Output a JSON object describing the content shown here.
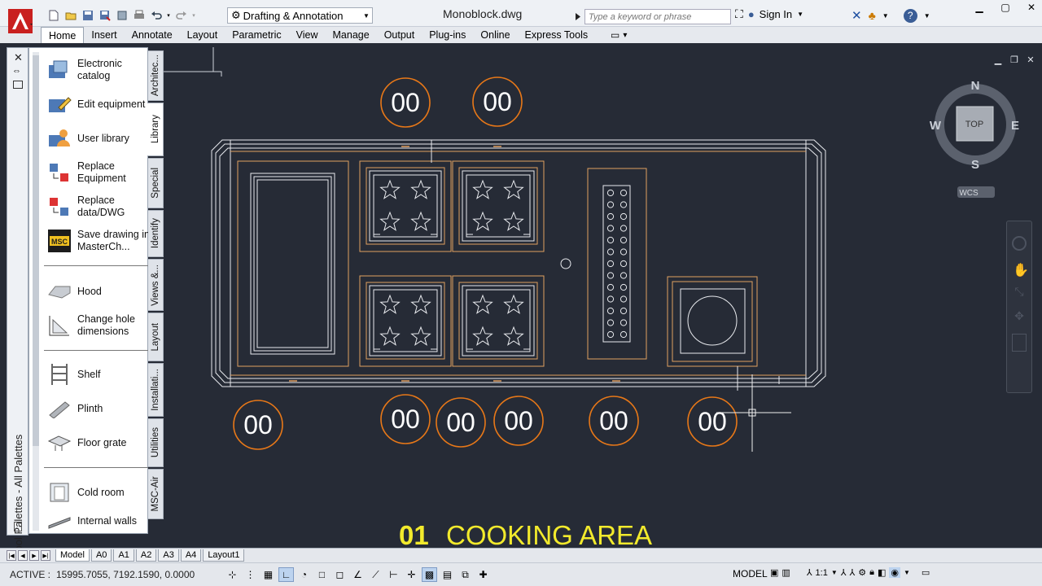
{
  "app": {
    "title": "Monoblock.dwg",
    "accent": "#d82627"
  },
  "workspace": {
    "label": "Drafting & Annotation"
  },
  "search": {
    "placeholder": "Type a keyword or phrase"
  },
  "user": {
    "sign_in": "Sign In"
  },
  "menu": {
    "tabs": [
      "Home",
      "Insert",
      "Annotate",
      "Layout",
      "Parametric",
      "View",
      "Manage",
      "Output",
      "Plug-ins",
      "Online",
      "Express Tools"
    ],
    "active": "Home"
  },
  "viewcube": {
    "north": "N",
    "south": "S",
    "east": "E",
    "west": "W",
    "face": "TOP",
    "wcs": "WCS"
  },
  "drawing": {
    "title_number": "01",
    "title_text": "COOKING AREA",
    "callout_label": "00",
    "colors": {
      "background": "#262b36",
      "outline": "#e0a060",
      "lines": "#e8eaee",
      "title": "#f2ea2c",
      "callout": "#e87818"
    }
  },
  "palette": {
    "title": "Tool Palettes - All Palettes",
    "tabs": [
      "Architec...",
      "Library",
      "Special",
      "Identify",
      "Views &...",
      "Layout",
      "Installati...",
      "Utilities",
      "MSC-Air"
    ],
    "active_tab": "Library",
    "items": [
      {
        "label": "Electronic catalog",
        "icon": "catalog-icon"
      },
      {
        "label": "Edit equipment",
        "icon": "edit-equipment-icon"
      },
      {
        "label": "User library",
        "icon": "user-library-icon"
      },
      {
        "label": "Replace Equipment",
        "icon": "replace-equipment-icon"
      },
      {
        "label": "Replace data/DWG",
        "icon": "replace-data-icon"
      },
      {
        "label": "Save drawing in MasterCh...",
        "icon": "msc-save-icon"
      },
      {
        "label": "Hood",
        "icon": "hood-icon"
      },
      {
        "label": "Change hole dimensions",
        "icon": "hole-dimensions-icon"
      },
      {
        "label": "Shelf",
        "icon": "shelf-icon"
      },
      {
        "label": "Plinth",
        "icon": "plinth-icon"
      },
      {
        "label": "Floor grate",
        "icon": "floor-grate-icon"
      },
      {
        "label": "Cold room",
        "icon": "cold-room-icon"
      },
      {
        "label": "Internal walls",
        "icon": "internal-walls-icon"
      }
    ]
  },
  "layout_tabs": {
    "items": [
      "Model",
      "A0",
      "A1",
      "A2",
      "A3",
      "A4",
      "Layout1"
    ],
    "active": "Model"
  },
  "status": {
    "active_label": "ACTIVE :",
    "coordinates": "15995.7055, 7192.1590, 0.0000",
    "model": "MODEL",
    "scale": "1:1"
  }
}
